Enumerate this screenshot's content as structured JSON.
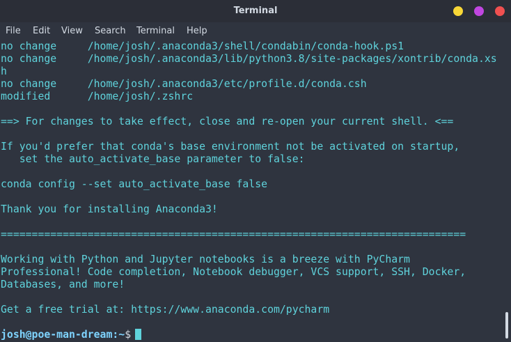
{
  "window": {
    "title": "Terminal"
  },
  "menu": {
    "items": [
      "File",
      "Edit",
      "View",
      "Search",
      "Terminal",
      "Help"
    ]
  },
  "terminal": {
    "lines": [
      "no change     /home/josh/.anaconda3/shell/condabin/conda-hook.ps1",
      "no change     /home/josh/.anaconda3/lib/python3.8/site-packages/xontrib/conda.xs",
      "h",
      "no change     /home/josh/.anaconda3/etc/profile.d/conda.csh",
      "modified      /home/josh/.zshrc",
      "",
      "==> For changes to take effect, close and re-open your current shell. <==",
      "",
      "If you'd prefer that conda's base environment not be activated on startup,",
      "   set the auto_activate_base parameter to false:",
      "",
      "conda config --set auto_activate_base false",
      "",
      "Thank you for installing Anaconda3!",
      "",
      "===========================================================================",
      "",
      "Working with Python and Jupyter notebooks is a breeze with PyCharm",
      "Professional! Code completion, Notebook debugger, VCS support, SSH, Docker,",
      "Databases, and more!",
      "",
      "Get a free trial at: https://www.anaconda.com/pycharm"
    ],
    "prompt": {
      "user_host": "josh@poe-man-dream",
      "path": ":~",
      "symbol": "$"
    }
  },
  "colors": {
    "background": "#2f343f",
    "text": "#5fd3dc",
    "prompt": "#7fd4ff"
  }
}
